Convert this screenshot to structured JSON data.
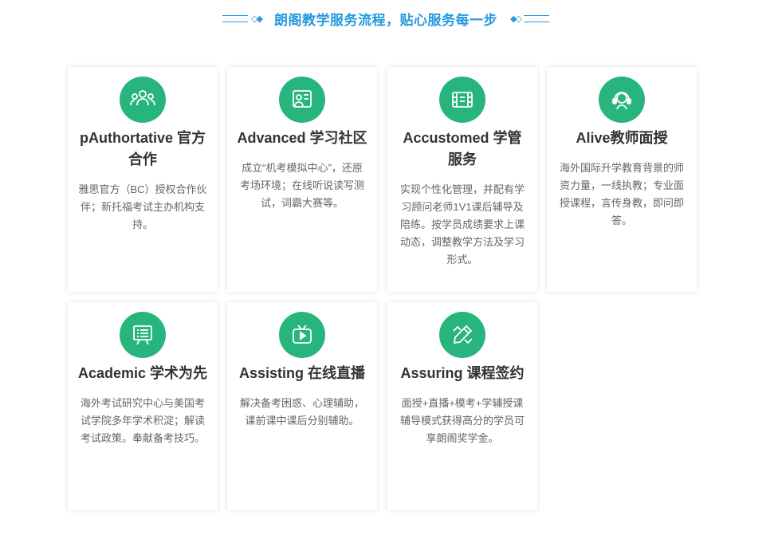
{
  "heading": {
    "title": "朗阁教学服务流程，贴心服务每一步",
    "left_deco": "◇◆",
    "right_deco": "◆◇"
  },
  "colors": {
    "accent": "#2499dd",
    "icon_bg": "#27b57d"
  },
  "cards": [
    {
      "icon": "team-icon",
      "title": "pAuthortative 官方合作",
      "desc": "雅思官方（BC）授权合作伙伴；新托福考试主办机构支持。"
    },
    {
      "icon": "presenter-board-icon",
      "title": "Advanced 学习社区",
      "desc": "成立“机考模拟中心”，还原考场环境；在线听说读写测试，词霸大赛等。"
    },
    {
      "icon": "film-strip-icon",
      "title": "Accustomed 学管服务",
      "desc": "实现个性化管理，并配有学习顾问老师1V1课后辅导及陪练。按学员成绩要求上课动态，调整教学方法及学习形式。"
    },
    {
      "icon": "headset-icon",
      "title": "Alive教师面授",
      "desc": "海外国际升学教育背景的师资力量，一线执教；专业面授课程，言传身教，即问即答。"
    },
    {
      "icon": "whiteboard-icon",
      "title": "Academic 学术为先",
      "desc": "海外考试研究中心与美国考试学院多年学术积淀；解读考试政策。奉献备考技巧。"
    },
    {
      "icon": "tv-play-icon",
      "title": "Assisting 在线直播",
      "desc": "解决备考困惑、心理辅助，课前课中课后分别辅助。"
    },
    {
      "icon": "pencil-ruler-icon",
      "title": "Assuring 课程签约",
      "desc": "面授+直播+模考+学辅授课辅导模式获得高分的学员可享朗阁奖学金。"
    }
  ]
}
